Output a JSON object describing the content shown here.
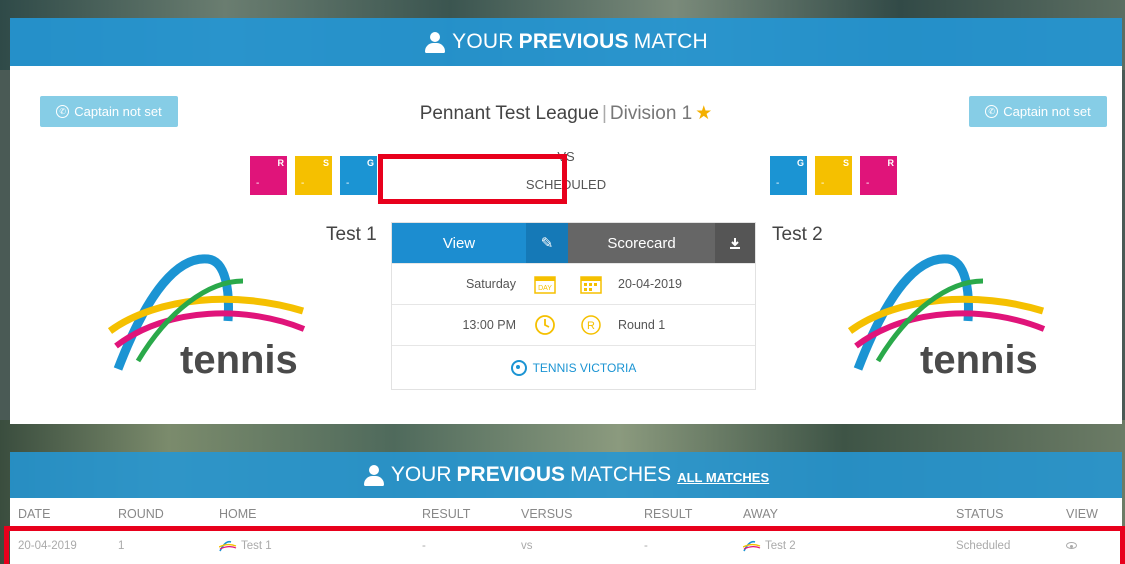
{
  "top_banner": {
    "prefix": "YOUR",
    "bold": "PREVIOUS",
    "suffix": "MATCH"
  },
  "captain_left": "Captain not set",
  "captain_right": "Captain not set",
  "league": {
    "name": "Pennant Test League",
    "separator": "|",
    "division": "Division 1"
  },
  "match": {
    "vs": "VS",
    "status": "SCHEDULED"
  },
  "home_badges": [
    {
      "letter": "R",
      "value": "-"
    },
    {
      "letter": "S",
      "value": "-"
    },
    {
      "letter": "G",
      "value": "-"
    }
  ],
  "away_badges": [
    {
      "letter": "G",
      "value": "-"
    },
    {
      "letter": "S",
      "value": "-"
    },
    {
      "letter": "R",
      "value": "-"
    }
  ],
  "home_team": "Test 1",
  "away_team": "Test 2",
  "logo_text": "tennis",
  "buttons": {
    "view": "View",
    "scorecard": "Scorecard"
  },
  "details": {
    "day": "Saturday",
    "day_icon": "DAY",
    "date": "20-04-2019",
    "time": "13:00 PM",
    "round_icon": "R",
    "round": "Round 1",
    "venue": "TENNIS VICTORIA"
  },
  "bottom_banner": {
    "prefix": "YOUR",
    "bold": "PREVIOUS",
    "suffix": "MATCHES",
    "link": "ALL MATCHES"
  },
  "table": {
    "headers": [
      "DATE",
      "ROUND",
      "HOME",
      "RESULT",
      "VERSUS",
      "RESULT",
      "AWAY",
      "STATUS",
      "VIEW"
    ],
    "row": {
      "date": "20-04-2019",
      "round": "1",
      "home": "Test 1",
      "result1": "-",
      "versus": "vs",
      "result2": "-",
      "away": "Test 2",
      "status": "Scheduled"
    }
  },
  "colors": {
    "banner_blue": "#2496d4",
    "badge_r": "#e0147a",
    "badge_s": "#f5c000",
    "badge_g": "#1b94d3",
    "highlight_red": "#e8001c",
    "view_btn": "#1c8dd0",
    "scorecard_btn": "#666666"
  }
}
